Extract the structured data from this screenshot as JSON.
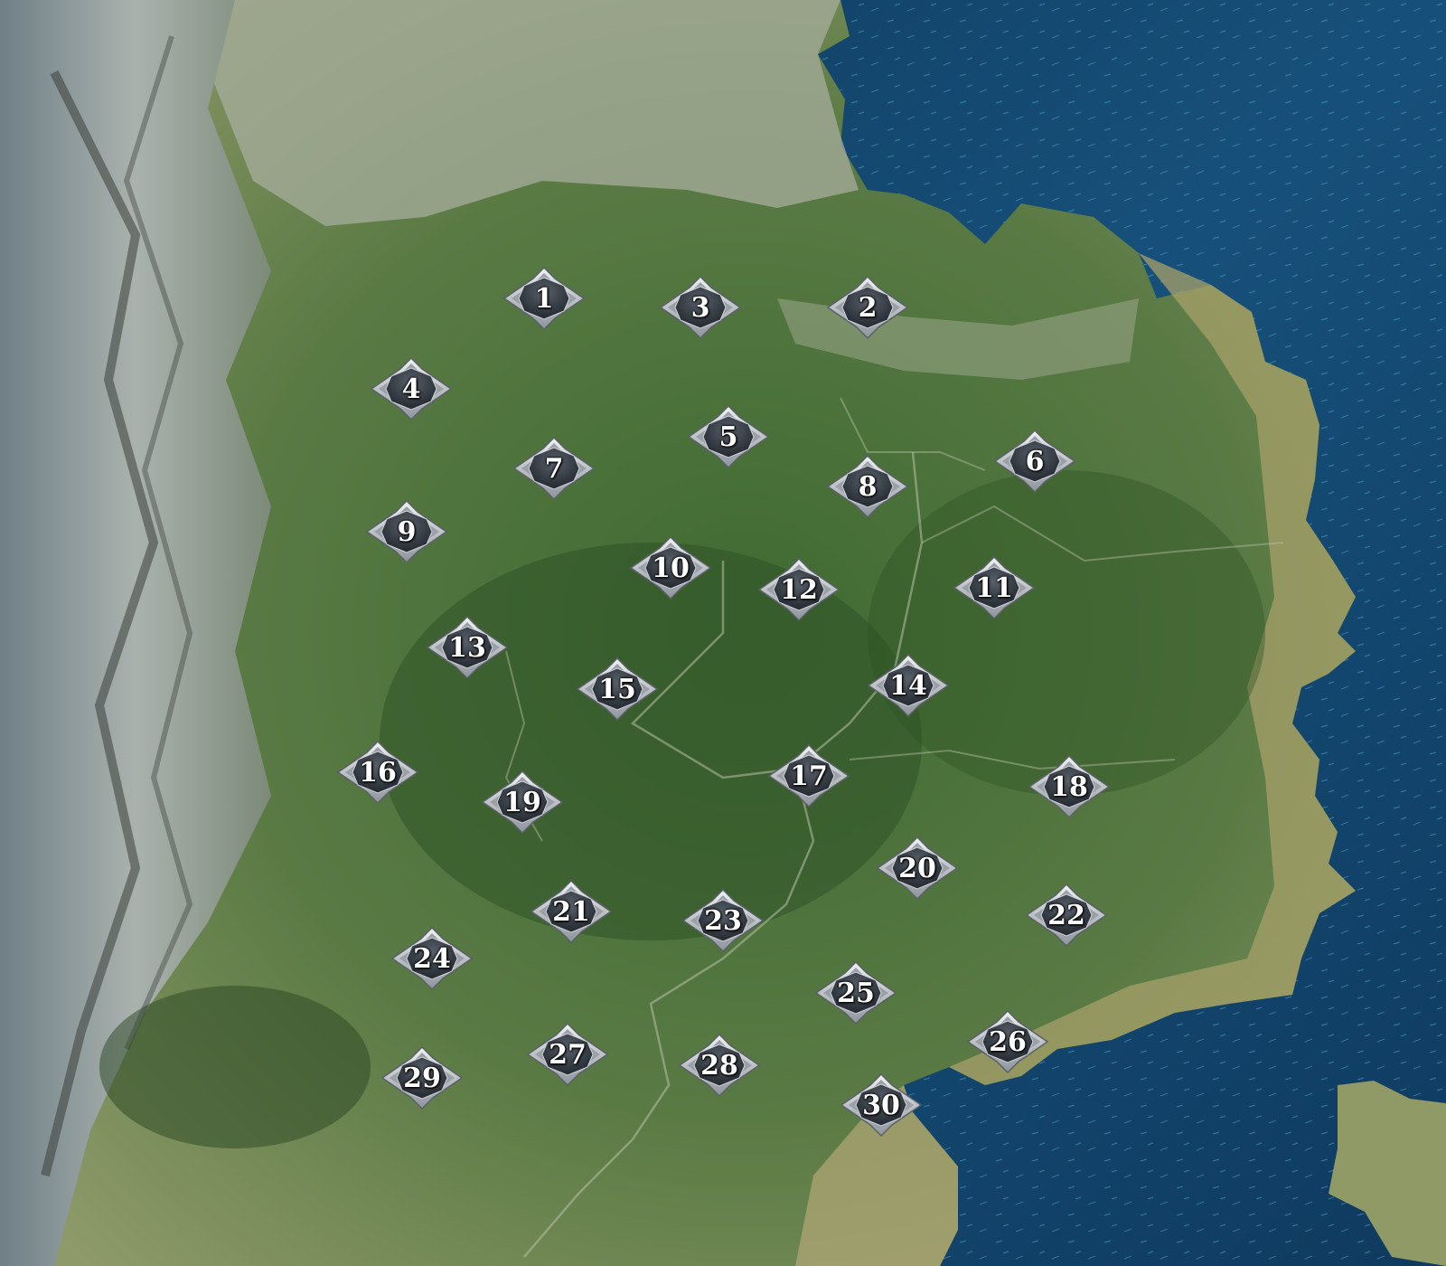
{
  "map": {
    "colors": {
      "ocean": "#123a5e",
      "land": "#5c7a43",
      "mountain": "#8f9a8e",
      "node_face": "#2f353b",
      "node_rim": "#c9ccd0"
    },
    "nodes": [
      {
        "label": "1"
      },
      {
        "label": "2"
      },
      {
        "label": "3"
      },
      {
        "label": "4"
      },
      {
        "label": "5"
      },
      {
        "label": "6"
      },
      {
        "label": "7"
      },
      {
        "label": "8"
      },
      {
        "label": "9"
      },
      {
        "label": "10"
      },
      {
        "label": "11"
      },
      {
        "label": "12"
      },
      {
        "label": "13"
      },
      {
        "label": "14"
      },
      {
        "label": "15"
      },
      {
        "label": "16"
      },
      {
        "label": "17"
      },
      {
        "label": "18"
      },
      {
        "label": "19"
      },
      {
        "label": "20"
      },
      {
        "label": "21"
      },
      {
        "label": "22"
      },
      {
        "label": "23"
      },
      {
        "label": "24"
      },
      {
        "label": "25"
      },
      {
        "label": "26"
      },
      {
        "label": "27"
      },
      {
        "label": "28"
      },
      {
        "label": "29"
      },
      {
        "label": "30"
      }
    ]
  }
}
